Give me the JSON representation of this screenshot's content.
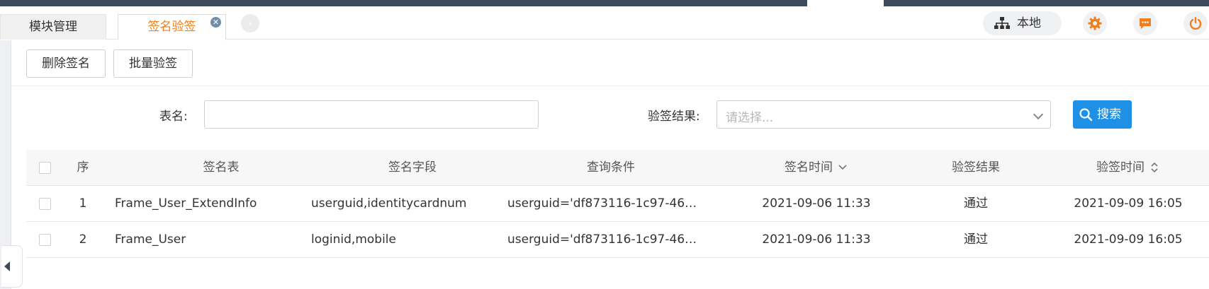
{
  "tabs": {
    "module_mgmt": "模块管理",
    "sign_verify": "签名验签",
    "close_symbol": "✕",
    "next_symbol": "›"
  },
  "header": {
    "location_label": "本地",
    "icons": [
      "network-icon",
      "gear-icon",
      "message-icon",
      "power-icon"
    ],
    "icon_color": "#f07e1e"
  },
  "toolbar": {
    "delete_sign_label": "删除签名",
    "batch_verify_label": "批量验签"
  },
  "filters": {
    "table_name_label": "表名:",
    "table_name_value": "",
    "verify_result_label": "验签结果:",
    "verify_result_placeholder": "请选择...",
    "search_label": "搜索"
  },
  "grid": {
    "columns": [
      "序",
      "签名表",
      "签名字段",
      "查询条件",
      "签名时间",
      "验签结果",
      "验签时间"
    ],
    "rows": [
      {
        "index": "1",
        "table": "Frame_User_ExtendInfo",
        "fields": "userguid,identitycardnum",
        "condition": "userguid='df873116-1c97-46…",
        "sign_time": "2021-09-06 11:33",
        "verify_result": "通过",
        "verify_time": "2021-09-09 16:05"
      },
      {
        "index": "2",
        "table": "Frame_User",
        "fields": "loginid,mobile",
        "condition": "userguid='df873116-1c97-46…",
        "sign_time": "2021-09-06 11:33",
        "verify_result": "通过",
        "verify_time": "2021-09-09 16:05"
      }
    ]
  },
  "colors": {
    "accent_orange": "#f07e1e",
    "primary_blue": "#1e90e6",
    "topbar_dark": "#3d4a5c"
  }
}
